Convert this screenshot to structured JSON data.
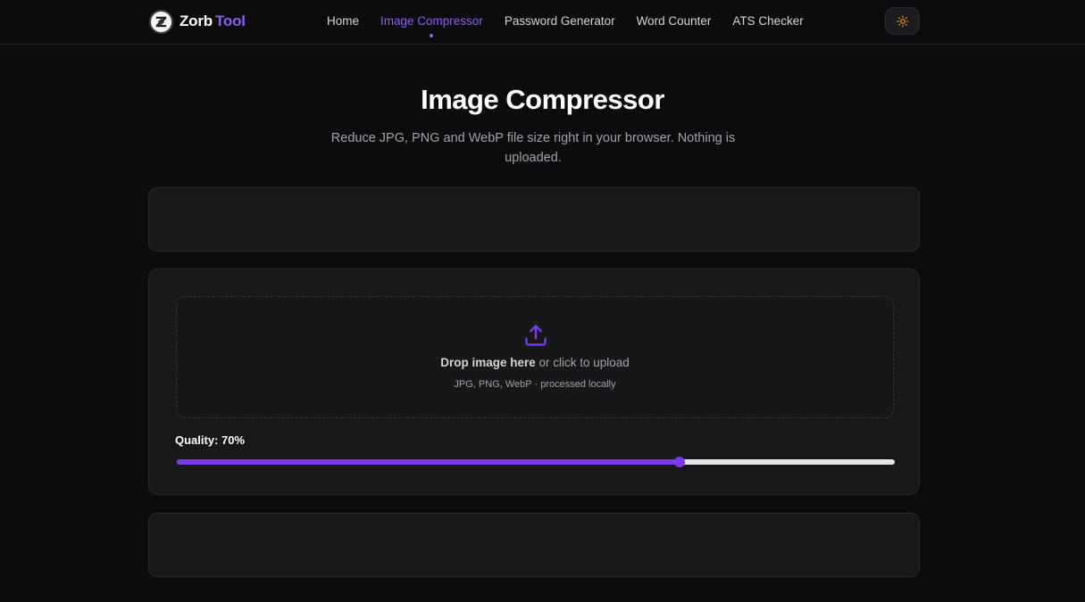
{
  "header": {
    "brand_part1": "Zorb",
    "brand_part2": "Tool",
    "nav": [
      {
        "label": "Home",
        "active": false
      },
      {
        "label": "Image Compressor",
        "active": true
      },
      {
        "label": "Password Generator",
        "active": false
      },
      {
        "label": "Word Counter",
        "active": false
      },
      {
        "label": "ATS Checker",
        "active": false
      }
    ],
    "theme_toggle_icon": "sun-icon"
  },
  "page": {
    "title": "Image Compressor",
    "subtitle": "Reduce JPG, PNG and WebP file size right in your browser. Nothing is uploaded."
  },
  "uploader": {
    "icon": "upload-icon",
    "drop_strong": "Drop image here",
    "drop_rest": " or click to upload",
    "hint": "JPG, PNG, WebP · processed locally"
  },
  "quality": {
    "label": "Quality: 70%",
    "value": 0.7
  },
  "colors": {
    "accent": "#8b5cf6",
    "background": "#0c0c0e",
    "card": "#18181b",
    "theme_icon": "#f59e0b"
  }
}
